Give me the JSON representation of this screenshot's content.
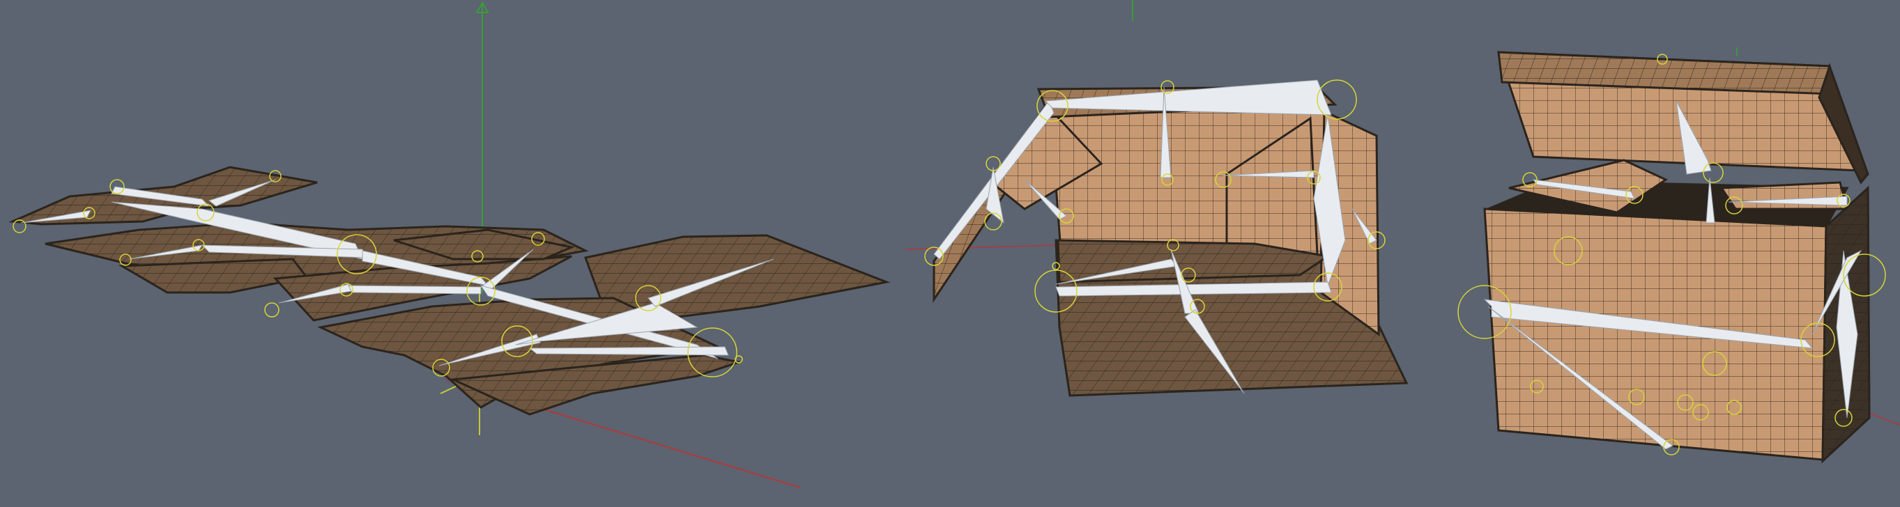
{
  "viewport": {
    "background": "#5b6470",
    "grid_visible": false,
    "axes": {
      "x_color": "#b0383c",
      "y_color": "#c8c834",
      "z_color": "#3c9a3c"
    }
  },
  "stages": [
    {
      "name": "flat-unfolded-box",
      "state": "unfolded"
    },
    {
      "name": "partially-folded-box",
      "state": "half-folded"
    },
    {
      "name": "folded-box",
      "state": "folded",
      "lid": "open"
    }
  ],
  "colors": {
    "cardboard_dark": "#6e5640",
    "cardboard_light": "#c89a74",
    "cardboard_mid": "#a07a58",
    "wireframe": "#2b241d",
    "bone_fill": "#e8ecf0",
    "bone_outline": "#9aa4ae",
    "joint_ring": "#d8d438"
  },
  "icons": {
    "joint": "joint-ring-icon",
    "bone": "bone-icon"
  }
}
